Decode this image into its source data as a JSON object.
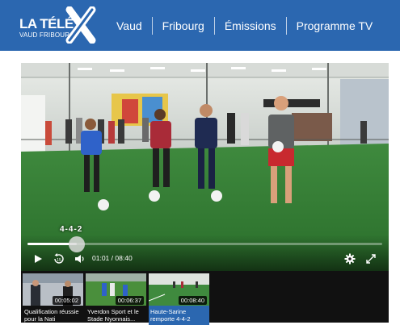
{
  "header": {
    "logo_main": "LA TÉLÉ",
    "logo_sub": "VAUD FRIBOURG",
    "nav": [
      {
        "label": "Vaud"
      },
      {
        "label": "Fribourg"
      },
      {
        "label": "Émissions"
      },
      {
        "label": "Programme TV"
      }
    ],
    "background_color": "#2b67b0"
  },
  "player": {
    "progress_fraction": 0.14,
    "preview_label": "4-4-2",
    "current_time": "01:01",
    "separator": "/",
    "duration": "08:40",
    "icons": [
      "play-icon",
      "replay-15-icon",
      "volume-icon",
      "settings-gear-icon",
      "fullscreen-icon"
    ]
  },
  "playlist": [
    {
      "duration": "00:05:02",
      "title": "Qualification réussie pour la Nati",
      "active": false
    },
    {
      "duration": "00:06:37",
      "title": "Yverdon Sport et le Stade Nyonnais...",
      "active": false
    },
    {
      "duration": "00:08:40",
      "title": "Haute-Sarine remporte 4-4-2",
      "active": true
    }
  ]
}
